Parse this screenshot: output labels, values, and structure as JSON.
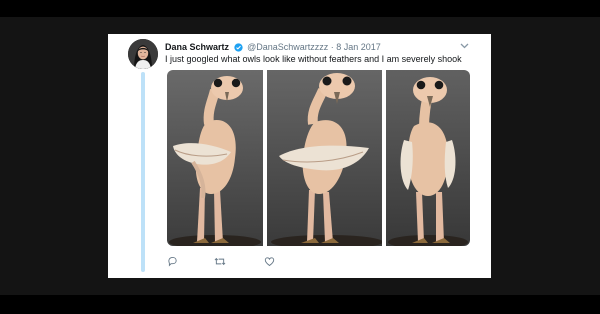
{
  "tweet": {
    "author_name": "Dana Schwartz",
    "handle": "@DanaSchwartzzzz",
    "separator": "·",
    "date": "8 Jan 2017",
    "text": "I just googled what owls look like without feathers and I am severely shook",
    "verified": true
  },
  "media": {
    "photos": [
      "featherless-owl-photo",
      "featherless-owl-photo",
      "featherless-owl-photo"
    ]
  },
  "actions": [
    "reply-icon",
    "retweet-icon",
    "like-icon"
  ],
  "colors": {
    "accent": "#1da1f2",
    "thread_line": "#bde1f8",
    "secondary_text": "#657786",
    "primary_text": "#14171a",
    "photo_background": "#4f4f4f",
    "owl_skin": "#e7c2a4"
  }
}
